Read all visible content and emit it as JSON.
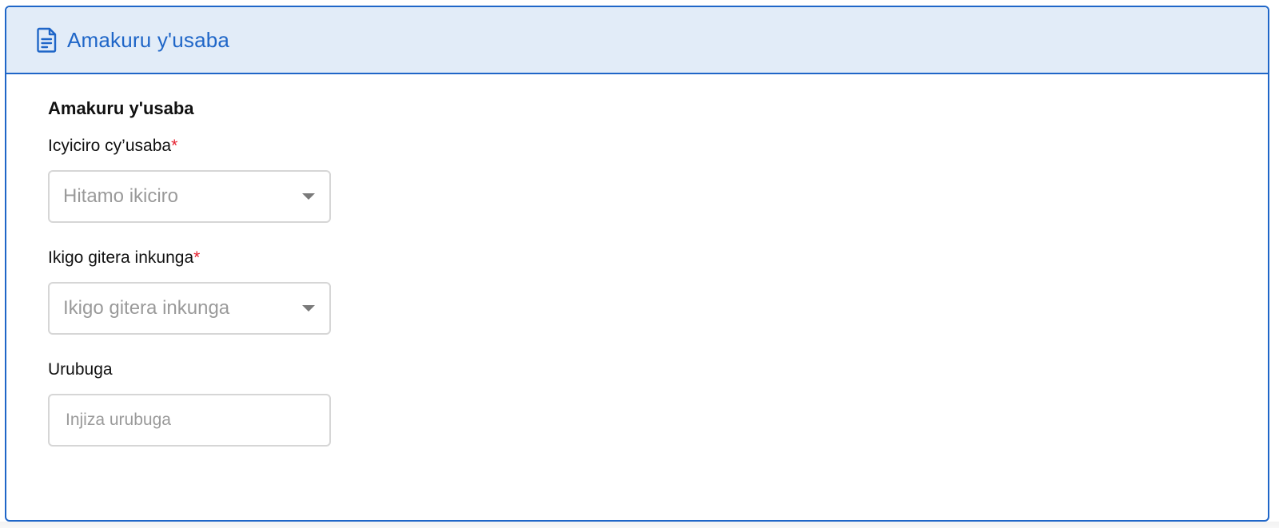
{
  "card": {
    "header_title": "Amakuru y'usaba",
    "header_icon": "document-icon",
    "accent_color": "#1f66c8",
    "header_bg": "#e2ecf8"
  },
  "form": {
    "section_title": "Amakuru y'usaba",
    "fields": [
      {
        "label": "Icyiciro cy’usaba",
        "required_mark": "*",
        "type": "select",
        "placeholder": "Hitamo ikiciro"
      },
      {
        "label": "Ikigo gitera inkunga",
        "required_mark": "*",
        "type": "select",
        "placeholder": "Ikigo gitera inkunga"
      },
      {
        "label": "Urubuga",
        "required_mark": "",
        "type": "text",
        "placeholder": "Injiza urubuga",
        "value": ""
      }
    ]
  }
}
